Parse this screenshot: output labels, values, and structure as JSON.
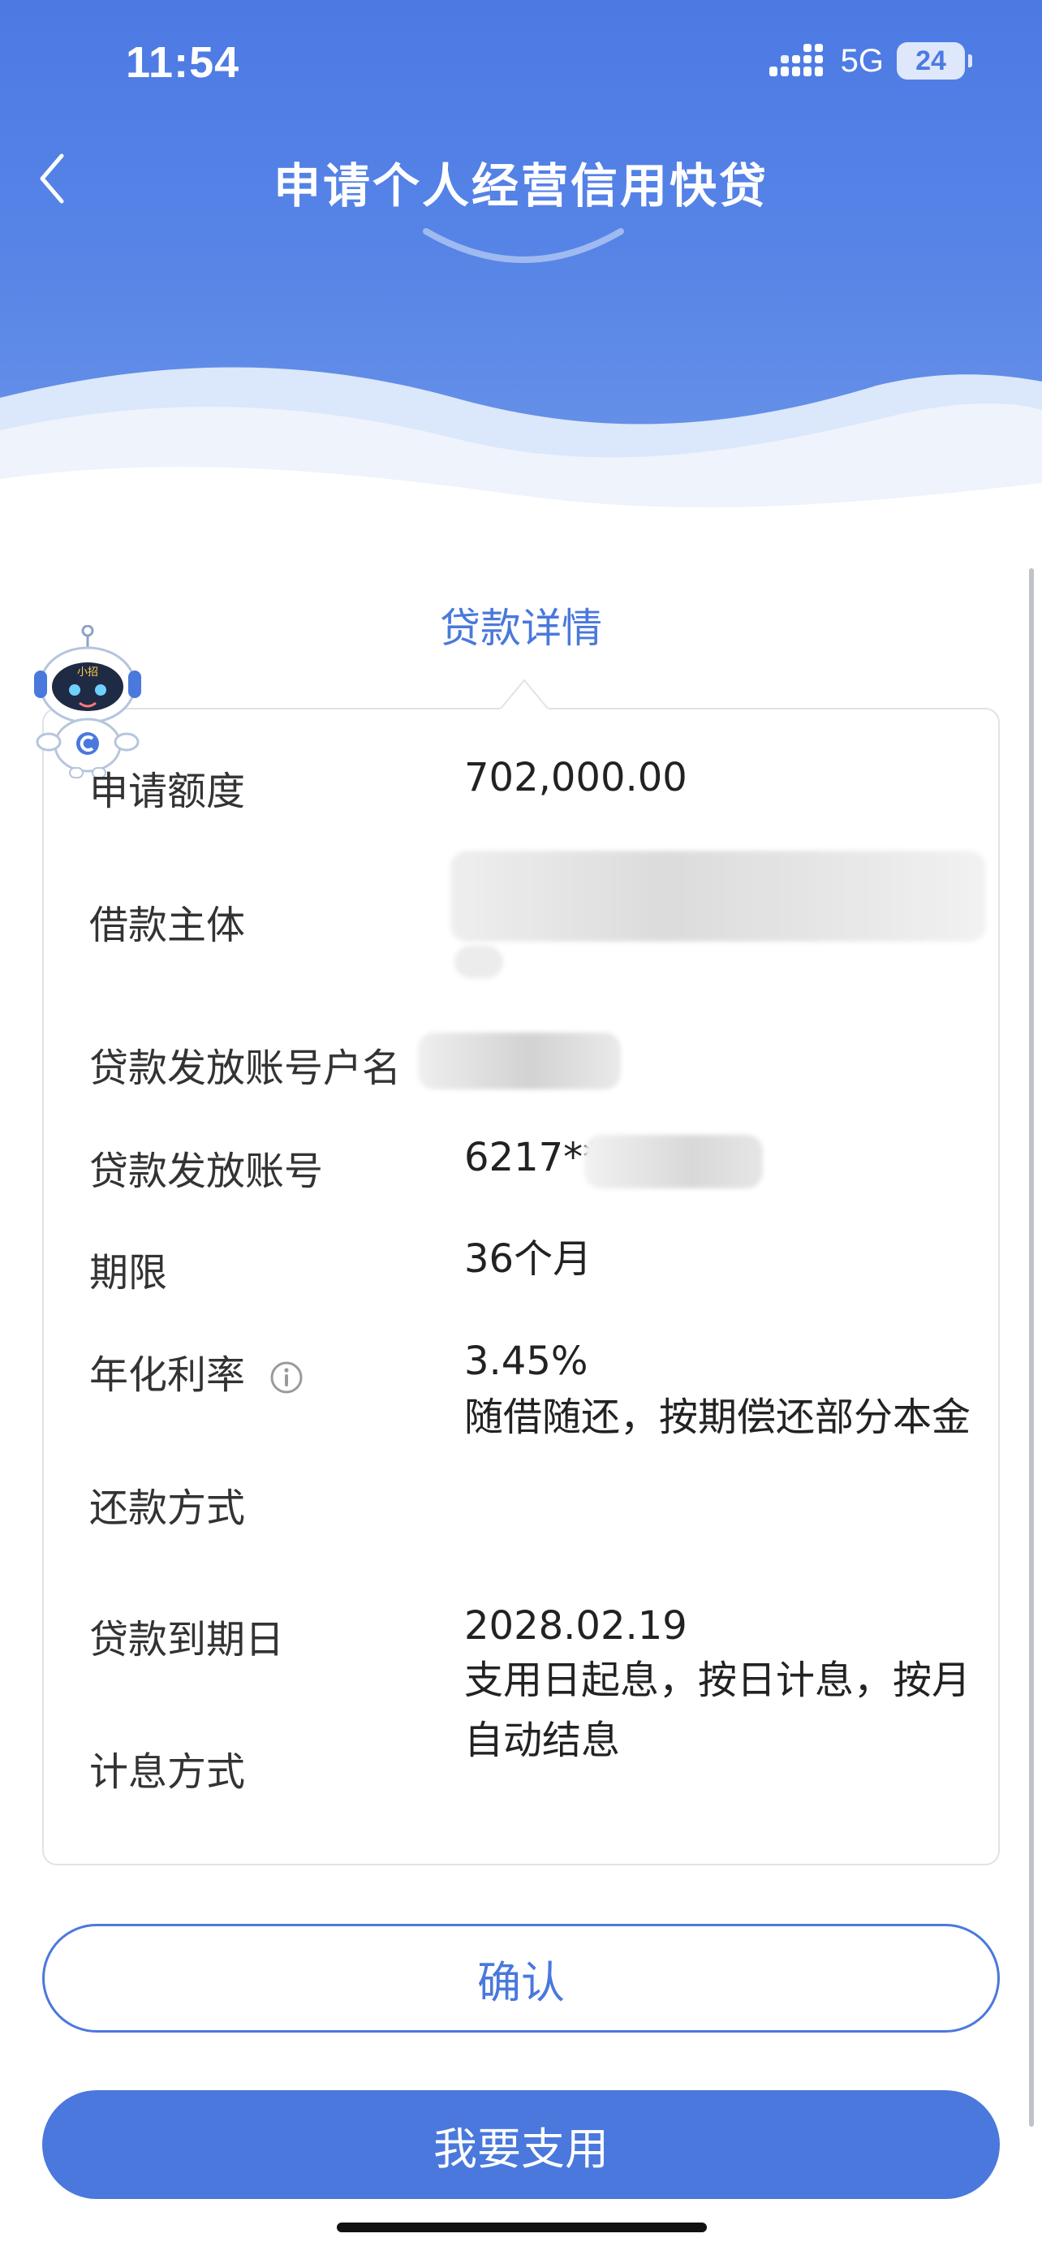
{
  "status_bar": {
    "time": "11:54",
    "network": "5G",
    "battery": "24"
  },
  "nav": {
    "title": "申请个人经营信用快贷"
  },
  "section": {
    "title": "贷款详情"
  },
  "robot": {
    "badge": "小招"
  },
  "details": [
    {
      "label": "申请额度",
      "value": "702,000.00"
    },
    {
      "label": "借款主体",
      "value": ""
    },
    {
      "label": "贷款发放账号户名",
      "value": ""
    },
    {
      "label": "贷款发放账号",
      "value": "6217**"
    },
    {
      "label": "期限",
      "value": "36个月"
    },
    {
      "label": "年化利率",
      "value": "3.45%"
    },
    {
      "label": "还款方式",
      "value": "随借随还，按期偿还部分本金"
    },
    {
      "label": "贷款到期日",
      "value": "2028.02.19"
    },
    {
      "label": "计息方式",
      "value": "支用日起息，按日计息，按月自动结息"
    }
  ],
  "buttons": {
    "confirm": "确认",
    "withdraw": "我要支用"
  },
  "colors": {
    "primary": "#4a78dc",
    "header": "#4c7ae3"
  }
}
